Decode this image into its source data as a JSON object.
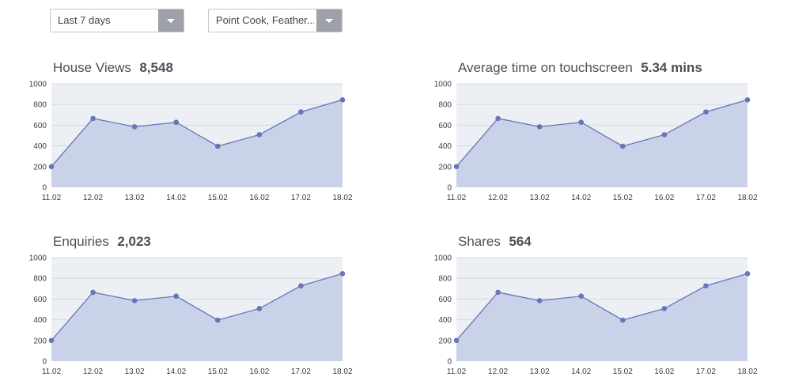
{
  "filters": {
    "range": {
      "label": "Last 7 days",
      "icon": "chevron-down-icon"
    },
    "location": {
      "label": "Point Cook, Feather...",
      "icon": "chevron-down-icon"
    }
  },
  "colors": {
    "plot_bg": "#eceff4",
    "area_fill": "#c9d2e8",
    "line": "#6676b8",
    "grid": "#d3d8e2",
    "dropdown_button": "#9ea2a8"
  },
  "chart_data": [
    {
      "type": "area",
      "title": "House Views",
      "metric": "8,548",
      "x": [
        "11.02",
        "12.02",
        "13.02",
        "14.02",
        "15.02",
        "16.02",
        "17.02",
        "18.02"
      ],
      "values": [
        200,
        665,
        585,
        628,
        397,
        508,
        728,
        845
      ],
      "yticks": [
        0,
        200,
        400,
        600,
        800,
        1000
      ],
      "ylim": [
        0,
        1000
      ],
      "grid": true
    },
    {
      "type": "area",
      "title": "Average time on touchscreen",
      "metric": "5.34 mins",
      "x": [
        "11.02",
        "12.02",
        "13.02",
        "14.02",
        "15.02",
        "16.02",
        "17.02",
        "18.02"
      ],
      "values": [
        200,
        665,
        585,
        628,
        397,
        508,
        728,
        845
      ],
      "yticks": [
        0,
        200,
        400,
        600,
        800,
        1000
      ],
      "ylim": [
        0,
        1000
      ],
      "grid": true
    },
    {
      "type": "area",
      "title": "Enquiries",
      "metric": "2,023",
      "x": [
        "11.02",
        "12.02",
        "13.02",
        "14.02",
        "15.02",
        "16.02",
        "17.02",
        "18.02"
      ],
      "values": [
        200,
        665,
        585,
        628,
        397,
        508,
        728,
        845
      ],
      "yticks": [
        0,
        200,
        400,
        600,
        800,
        1000
      ],
      "ylim": [
        0,
        1000
      ],
      "grid": true
    },
    {
      "type": "area",
      "title": "Shares",
      "metric": "564",
      "x": [
        "11.02",
        "12.02",
        "13.02",
        "14.02",
        "15.02",
        "16.02",
        "17.02",
        "18.02"
      ],
      "values": [
        200,
        665,
        585,
        628,
        397,
        508,
        728,
        845
      ],
      "yticks": [
        0,
        200,
        400,
        600,
        800,
        1000
      ],
      "ylim": [
        0,
        1000
      ],
      "grid": true
    }
  ]
}
